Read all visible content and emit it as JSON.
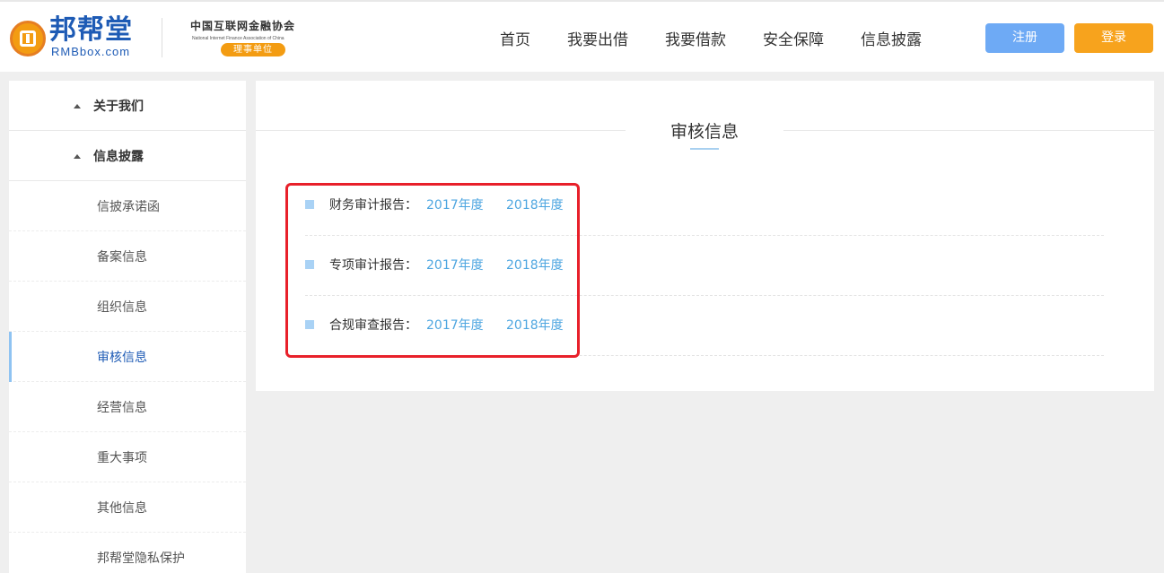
{
  "header": {
    "logo": {
      "cn": "邦帮堂",
      "en": "RMBbox.com"
    },
    "association": {
      "name": "中国互联网金融协会",
      "en": "National Internet Finance Association of China",
      "badge": "理事单位"
    },
    "nav": [
      "首页",
      "我要出借",
      "我要借款",
      "安全保障",
      "信息披露"
    ],
    "register_label": "注册",
    "login_label": "登录"
  },
  "sidebar": {
    "groups": [
      "关于我们",
      "信息披露"
    ],
    "items": [
      "信披承诺函",
      "备案信息",
      "组织信息",
      "审核信息",
      "经营信息",
      "重大事项",
      "其他信息",
      "邦帮堂隐私保护"
    ],
    "active": "审核信息"
  },
  "main": {
    "title": "审核信息",
    "reports": [
      {
        "label": "财务审计报告：",
        "links": [
          "2017年度",
          "2018年度"
        ]
      },
      {
        "label": "专项审计报告：",
        "links": [
          "2017年度",
          "2018年度"
        ]
      },
      {
        "label": "合规审查报告：",
        "links": [
          "2017年度",
          "2018年度"
        ]
      }
    ]
  },
  "colors": {
    "brand_blue": "#1e5bb5",
    "link_blue": "#4ea6e0",
    "register": "#6eaaf5",
    "login": "#f7a31d",
    "highlight": "#e8202a"
  }
}
